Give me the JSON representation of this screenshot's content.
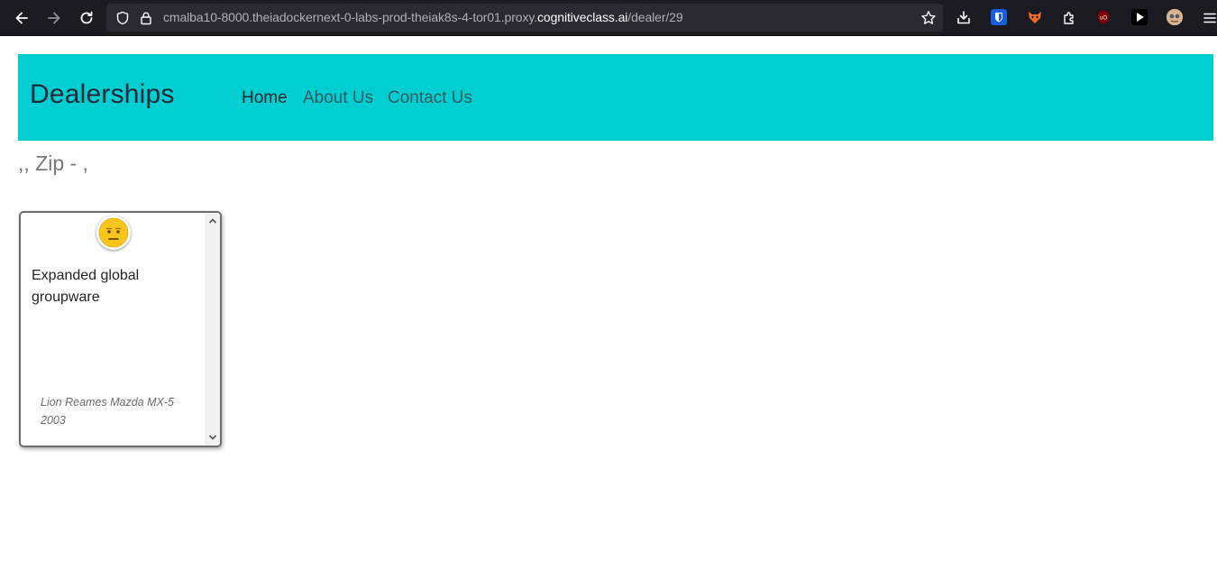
{
  "browser": {
    "url_prefix": "cmalba10-8000.theiadockernext-0-labs-prod-theiak8s-4-tor01.proxy.",
    "url_domain": "cognitiveclass.ai",
    "url_path": "/dealer/29",
    "icons": [
      "back-icon",
      "forward-icon",
      "reload-icon",
      "shield-icon",
      "lock-icon",
      "bookmark-star-icon",
      "save-pocket-icon",
      "bitwarden-icon",
      "fox-extension-icon",
      "extensions-icon",
      "ublock-icon",
      "media-play-icon",
      "profile-avatar-icon",
      "menu-icon"
    ]
  },
  "navbar": {
    "brand": "Dealerships",
    "links": [
      {
        "label": "Home"
      },
      {
        "label": "About Us"
      },
      {
        "label": "Contact Us"
      }
    ],
    "background": "#00ced1"
  },
  "dealer": {
    "heading": ",, Zip - ,"
  },
  "reviews": [
    {
      "sentiment_icon": "neutral-face-icon",
      "review": "Expanded global groupware",
      "car": "Lion Reames Mazda MX-5 2003"
    }
  ]
}
